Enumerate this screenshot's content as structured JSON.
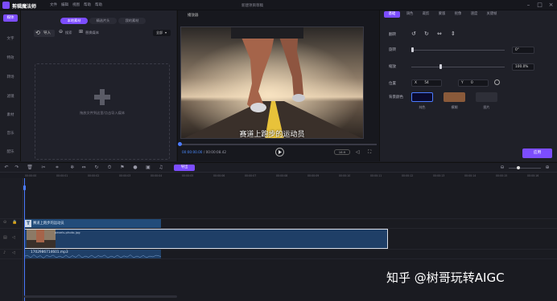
{
  "app": {
    "name": "剪辑魔法师",
    "window_title": "新建项目草稿",
    "menus": [
      "文件",
      "编辑",
      "视图",
      "帮助",
      "帮助"
    ]
  },
  "sidebar": {
    "items": [
      {
        "label": "媒体",
        "icon": "media-icon",
        "active": true
      },
      {
        "label": "文字",
        "icon": "text-icon"
      },
      {
        "label": "特效",
        "icon": "effects-icon"
      },
      {
        "label": "转场",
        "icon": "transition-icon"
      },
      {
        "label": "滤镜",
        "icon": "filter-icon"
      },
      {
        "label": "素材",
        "icon": "assets-icon"
      },
      {
        "label": "音乐",
        "icon": "music-icon"
      },
      {
        "label": "配乐",
        "icon": "soundtrack-icon"
      }
    ]
  },
  "media": {
    "tabs": [
      "本地素材",
      "精选片头",
      "我的素材"
    ],
    "import_label": "导入",
    "tool1": "搜索",
    "tool2": "替换媒体",
    "filter": "全部",
    "drop_hint": "拖放文件到这里/点击导入媒体"
  },
  "player": {
    "title": "播放器",
    "caption": "赛道上跑步的运动员",
    "time_current": "00:00:00.00",
    "time_total": "00:00:08.42",
    "ratio": "16:9"
  },
  "properties": {
    "tabs": [
      "基础",
      "调色",
      "裁剪",
      "蒙版",
      "抠像",
      "速度",
      "关键帧"
    ],
    "flip_label": "翻转",
    "rotate_label": "旋转",
    "rotate_value": "0°",
    "scale_label": "缩放",
    "scale_value": "100.0%",
    "scale_level": 0.3,
    "position_label": "位置",
    "x_label": "X",
    "x_value": "54",
    "y_label": "Y",
    "y_value": "0",
    "bg_label": "背景颜色",
    "swatches": [
      {
        "label": "纯色",
        "color": "#0a0a2e"
      },
      {
        "label": "模糊",
        "color": "#8a5a3a"
      },
      {
        "label": "图片",
        "color": "#2e2f38"
      }
    ],
    "apply_label": "应用"
  },
  "timeline": {
    "export_label": "导出",
    "ticks": [
      "00:00:00",
      "00:00:01",
      "00:00:02",
      "00:00:03",
      "00:00:04",
      "00:00:05",
      "00:00:06",
      "00:00:07",
      "00:00:08",
      "00:00:09",
      "00:00:10",
      "00:00:11",
      "00:00:12",
      "00:00:13",
      "00:00:14",
      "00:00:15",
      "00:00:16"
    ],
    "text_clip": "赛道上跑步的运动员",
    "video_clip": "pexels-photo.jpg",
    "audio_clip": "1702986714601.mp3"
  },
  "watermark": "知乎 @树哥玩转AIGC",
  "colors": {
    "accent": "#7c4dff",
    "clip": "#1f3f67",
    "playhead": "#4b7bff"
  }
}
